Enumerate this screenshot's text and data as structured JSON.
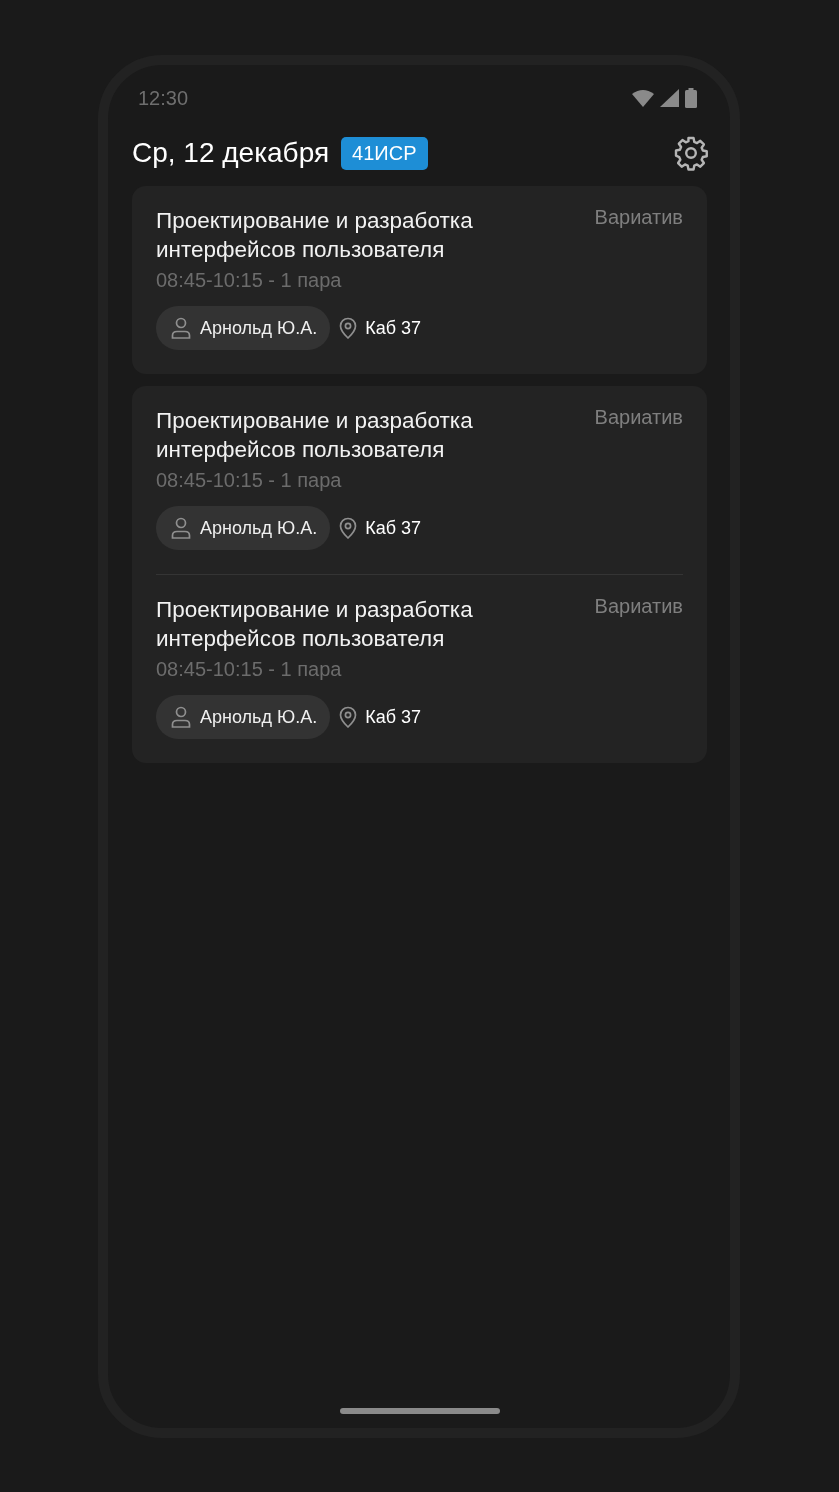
{
  "status_bar": {
    "time": "12:30"
  },
  "header": {
    "date": "Ср, 12 декабря",
    "group": "41ИСР"
  },
  "cards": [
    {
      "lessons": [
        {
          "title": "Проектирование и разработка интерфейсов пользователя",
          "type": "Вариатив",
          "time": "08:45-10:15 - 1 пара",
          "teacher": "Арнольд Ю.А.",
          "room": "Каб 37"
        }
      ]
    },
    {
      "lessons": [
        {
          "title": "Проектирование и разработка интерфейсов пользователя",
          "type": "Вариатив",
          "time": "08:45-10:15 - 1 пара",
          "teacher": "Арнольд Ю.А.",
          "room": "Каб 37"
        },
        {
          "title": "Проектирование и разработка интерфейсов пользователя",
          "type": "Вариатив",
          "time": "08:45-10:15 - 1 пара",
          "teacher": "Арнольд Ю.А.",
          "room": "Каб 37"
        }
      ]
    }
  ]
}
